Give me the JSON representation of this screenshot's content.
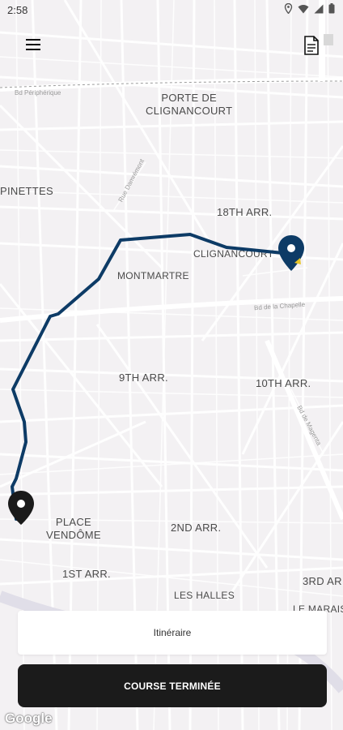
{
  "status_bar": {
    "time": "2:58",
    "icons": [
      "location-icon",
      "wifi-icon",
      "signal-icon",
      "battery-icon"
    ]
  },
  "header": {
    "menu_icon": "hamburger-menu-icon",
    "document_icon": "document-icon"
  },
  "map": {
    "labels": {
      "porte_de_clignancourt_1": "PORTE DE",
      "porte_de_clignancourt_2": "CLIGNANCOURT",
      "epinettes": "PINETTES",
      "arr18": "18TH ARR.",
      "clignancourt": "CLIGNANCOURT",
      "montmartre": "MONTMARTRE",
      "arr9": "9TH ARR.",
      "arr10": "10TH ARR.",
      "place_vendome_1": "PLACE",
      "place_vendome_2": "VENDÔME",
      "arr2": "2ND ARR.",
      "arr1": "1ST ARR.",
      "les_halles": "LES HALLES",
      "arr3": "3RD AR",
      "le_marais": "LE MARAIS",
      "bd_peripherique": "Bd Périphérique",
      "bd_chapelle": "Bd de la Chapelle",
      "bd_magenta": "Bd de Magenta",
      "rue_damremont": "Rue Damrémont"
    },
    "colors": {
      "route": "#0d3b66",
      "destination_pin": "#0d3b66",
      "origin_pin": "#1a1a1a",
      "background": "#f3f1f3"
    },
    "attribution": "Google"
  },
  "bottom": {
    "itinerary_label": "Itinéraire",
    "finish_label": "COURSE TERMINÉE"
  }
}
